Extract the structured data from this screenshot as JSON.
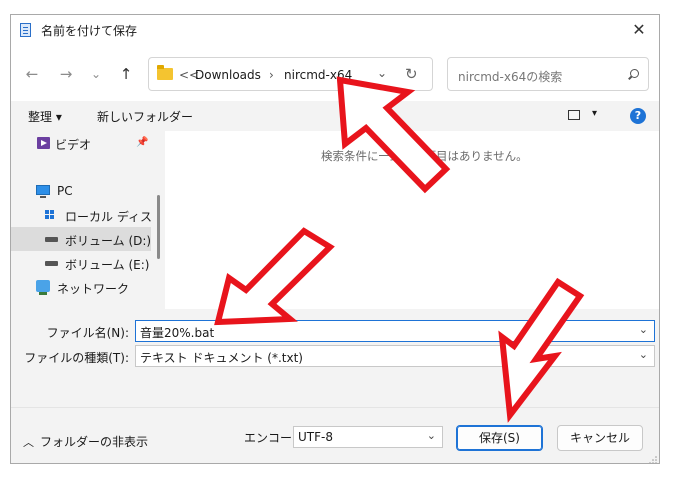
{
  "window": {
    "title": "名前を付けて保存",
    "close_symbol": "✕"
  },
  "nav": {
    "back": "←",
    "forward": "→",
    "recent": "⌄",
    "up": "↑",
    "address": {
      "overflow": "<<",
      "crumbs": [
        "Downloads",
        "nircmd-x64"
      ],
      "separator": "›"
    },
    "dropdown": "⌄",
    "refresh": "↻",
    "search_placeholder": "nircmd-x64の検索"
  },
  "toolbar": {
    "organize": "整理 ▾",
    "new_folder": "新しいフォルダー",
    "view_caret": "▾",
    "help": "?"
  },
  "sidebar": {
    "items": [
      {
        "label": "ビデオ",
        "icon": "video-icon",
        "pinned": true
      },
      {
        "label": "PC",
        "icon": "pc-icon"
      },
      {
        "label": "ローカル ディスク (C",
        "icon": "windows-drive-icon"
      },
      {
        "label": "ボリューム (D:)",
        "icon": "drive-icon",
        "selected": true
      },
      {
        "label": "ボリューム (E:)",
        "icon": "drive-icon"
      },
      {
        "label": "ネットワーク",
        "icon": "network-icon"
      }
    ],
    "pin_symbol": "📌"
  },
  "content": {
    "empty_message": "検索条件に一致する項目はありません。"
  },
  "form": {
    "filename_label": "ファイル名(N):",
    "filename_value": "音量20%.bat",
    "filetype_label": "ファイルの種類(T):",
    "filetype_value": "テキスト ドキュメント (*.txt)",
    "chevron": "⌄"
  },
  "bottom": {
    "hide_folders": "フォルダーの非表示",
    "hide_caret": "︿",
    "encoding_label": "エンコード:",
    "encoding_value": "UTF-8",
    "save_button": "保存(S)",
    "cancel_button": "キャンセル"
  },
  "colors": {
    "accent": "#1e73d6",
    "annotation_arrow": "#e8141c"
  }
}
